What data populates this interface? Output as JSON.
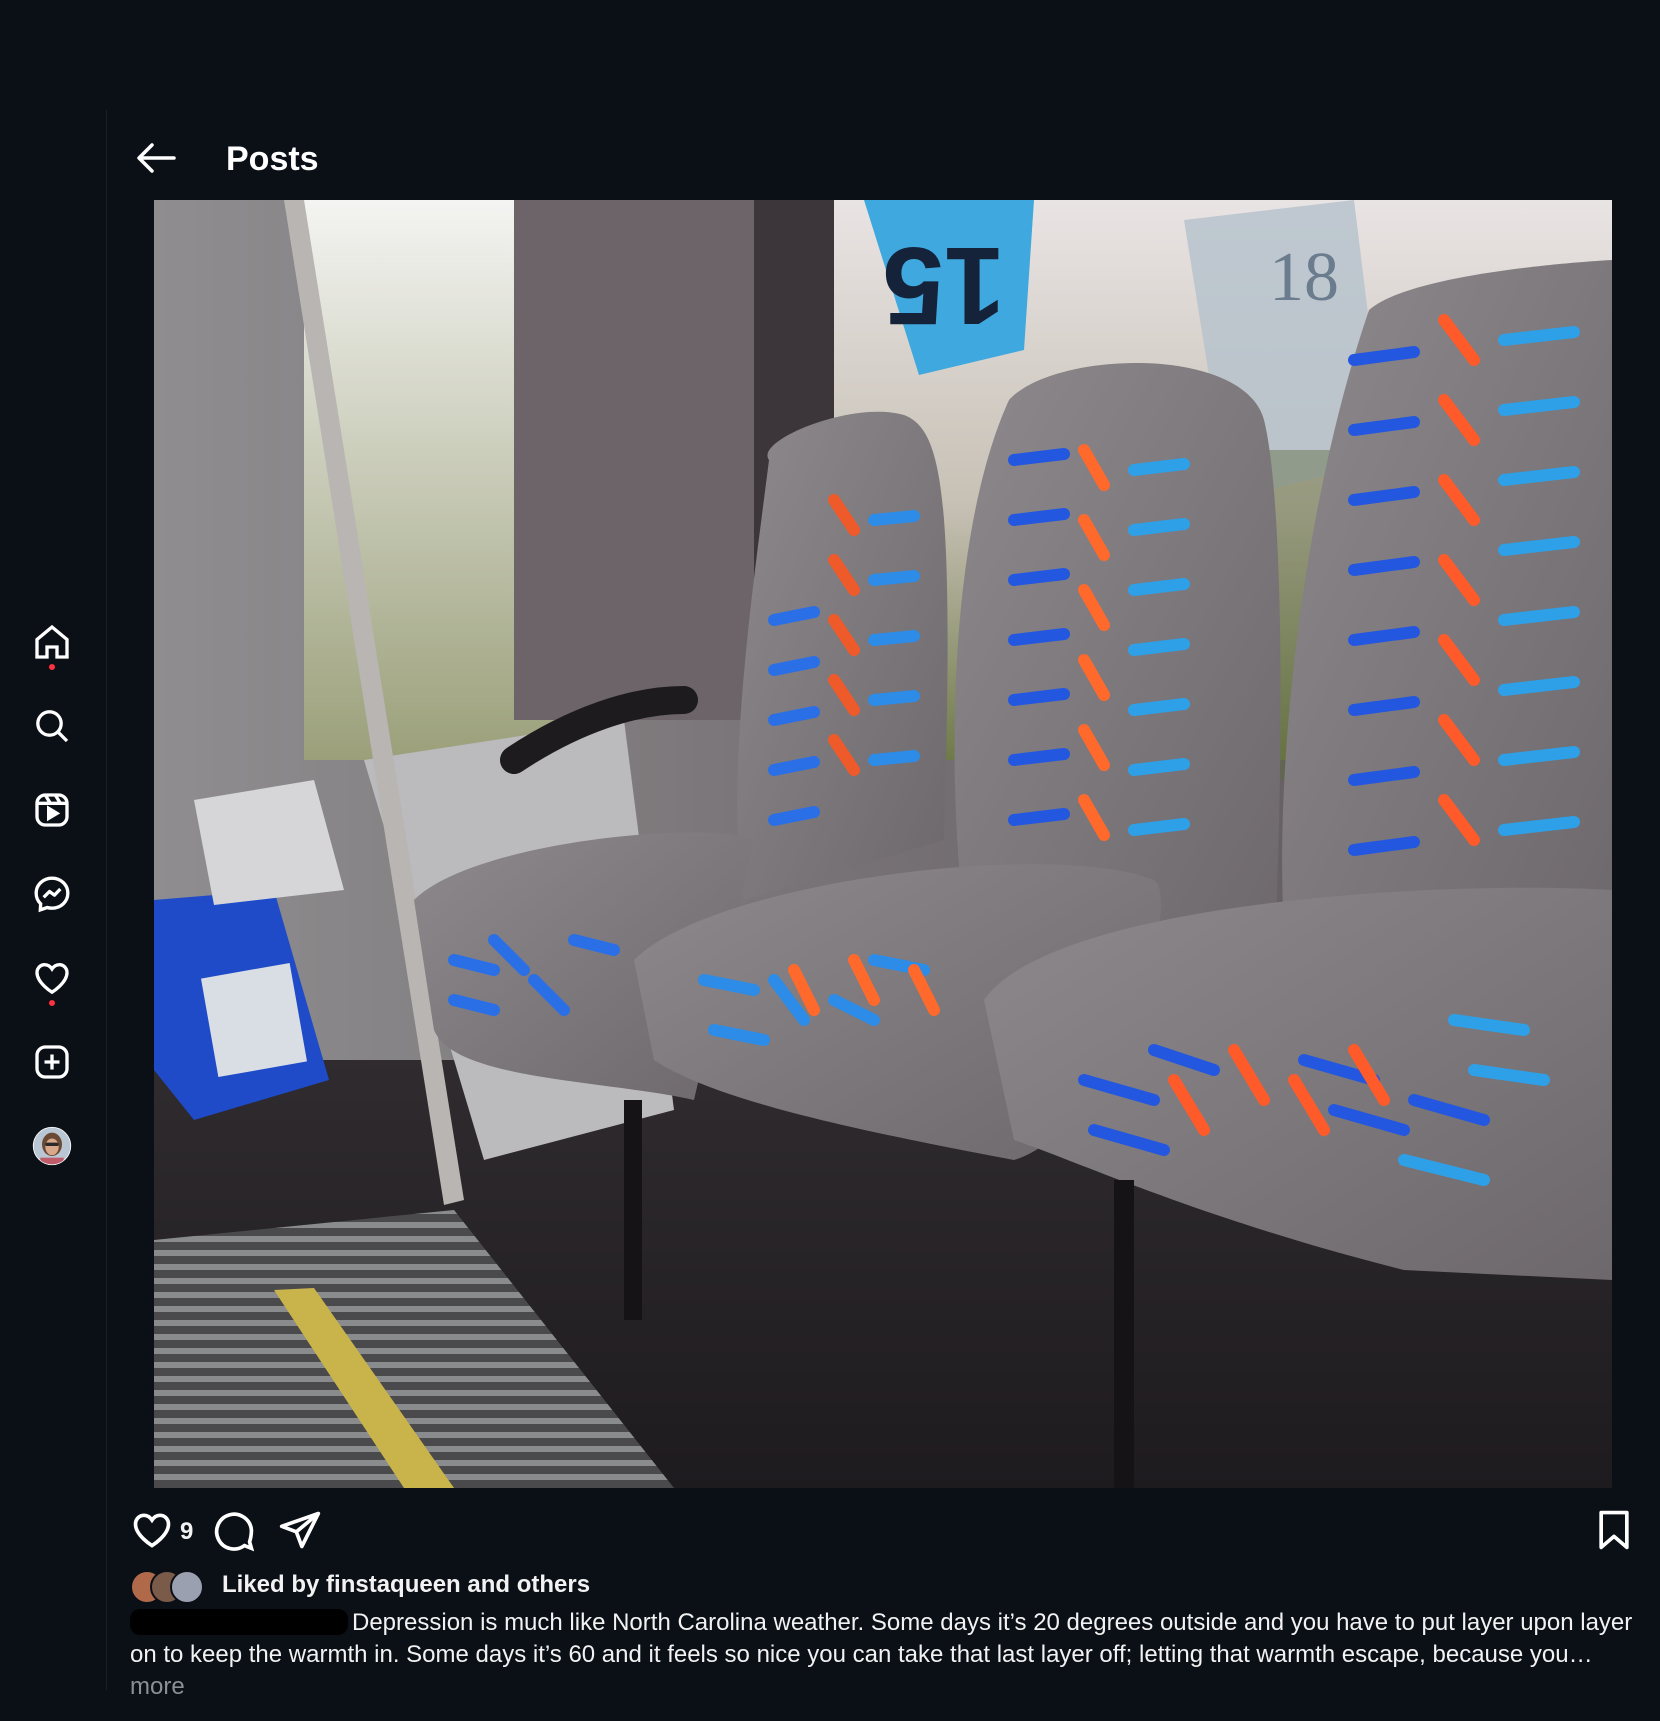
{
  "header": {
    "title": "Posts"
  },
  "sidebar": {
    "items": [
      {
        "icon": "home-icon"
      },
      {
        "icon": "search-icon"
      },
      {
        "icon": "reels-icon"
      },
      {
        "icon": "messenger-icon"
      },
      {
        "icon": "heart-icon"
      },
      {
        "icon": "create-icon"
      },
      {
        "icon": "profile-avatar"
      }
    ]
  },
  "post": {
    "image": {
      "sign_number": "15",
      "poster_number": "18"
    },
    "like_count": "9",
    "liked_by": "Liked by finstaqueen and others",
    "caption": "Depression is much like North Carolina weather. Some days it’s 20 degrees outside and you have to put layer upon layer on to keep the warmth in. Some days it’s 60 and it feels so nice you can take that last layer off; letting that warmth escape, because you…",
    "more_label": "more"
  },
  "colors": {
    "background": "#0b0f16",
    "notification": "#ff3040",
    "muted": "#8a8f98"
  }
}
